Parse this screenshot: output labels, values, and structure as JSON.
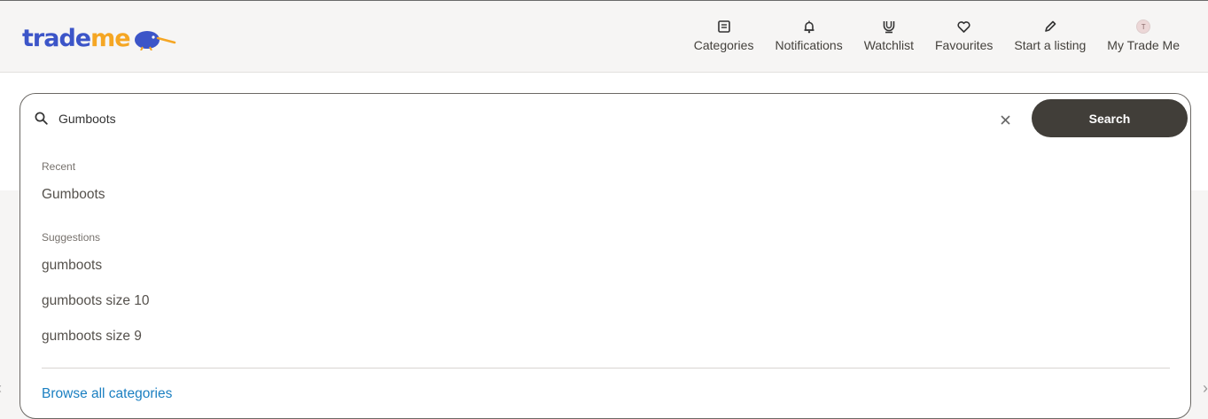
{
  "header": {
    "logo": {
      "part1": "trade",
      "part2": "me"
    },
    "nav": [
      {
        "label": "Categories",
        "icon": "categories-icon"
      },
      {
        "label": "Notifications",
        "icon": "bell-icon"
      },
      {
        "label": "Watchlist",
        "icon": "watchlist-icon"
      },
      {
        "label": "Favourites",
        "icon": "heart-icon"
      },
      {
        "label": "Start a listing",
        "icon": "pencil-icon"
      },
      {
        "label": "My Trade Me",
        "icon": "avatar",
        "avatar_initial": "T"
      }
    ]
  },
  "search": {
    "value": "Gumboots",
    "button_label": "Search",
    "recent_heading": "Recent",
    "recent": [
      "Gumboots"
    ],
    "suggestions_heading": "Suggestions",
    "suggestions": [
      "gumboots",
      "gumboots size 10",
      "gumboots size 9"
    ],
    "browse_label": "Browse all categories"
  },
  "colors": {
    "brand_blue": "#3c55c8",
    "brand_orange": "#f5a623",
    "search_button": "#413e39",
    "link": "#1a7fc1"
  }
}
